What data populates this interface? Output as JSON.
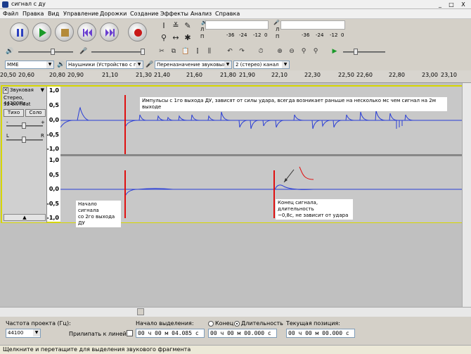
{
  "window": {
    "title": "сигнал с ду",
    "min": "_",
    "max": "□",
    "close": "X"
  },
  "menu": [
    "Файл",
    "Правка",
    "Вид",
    "Управление",
    "Дорожки",
    "Создание",
    "Эффекты",
    "Анализ",
    "Справка"
  ],
  "meters": {
    "playback": {
      "l": "Л",
      "r": "П",
      "ticks": [
        "-36",
        "-24",
        "-12",
        "0"
      ]
    },
    "record": {
      "l": "Л",
      "r": "П",
      "ticks": [
        "-36",
        "-24",
        "-12",
        "0"
      ]
    }
  },
  "device": {
    "host": "MME",
    "output": "Наушники (Устройство с под",
    "input": "Переназначение звуковых у",
    "channels": "2 (стерео) канал"
  },
  "ruler": {
    "ticks": [
      "20,50",
      "20,60",
      "20,80",
      "20,90",
      "21,10",
      "21,30",
      "21,40",
      "21,60",
      "21,80",
      "21,90",
      "22,10",
      "22,30",
      "22,50",
      "22,60",
      "22,80",
      "23,00",
      "23,10"
    ]
  },
  "track": {
    "name": "Звуковая",
    "info1": "Стерео, 44100Hz",
    "info2": "32-bit float",
    "mute": "Тихо",
    "solo": "Соло",
    "gain_minus": "-",
    "gain_plus": "+",
    "pan_l": "L",
    "pan_r": "R",
    "collapse": "▲"
  },
  "axis_labels": [
    "1,0",
    "0,5",
    "0,0",
    "-0,5",
    "-1,0"
  ],
  "annotations": {
    "top": "Импульсы с 1го выхода ДУ, зависят от силы удара, всегда возникает раньше на несколько мс чем сигнал на 2м выходе",
    "start1": "Начало сигнала",
    "start2": "со 2го выхода ДУ",
    "end1": "Конец сигнала, длительность",
    "end2": "~0,8с, не зависит от удара"
  },
  "bottom": {
    "rate_label": "Частота проекта (Гц):",
    "rate_value": "44100",
    "snap_label": "Прилипать к линейке",
    "sel_start_label": "Начало выделения:",
    "end_label": "Конец",
    "len_label": "Длительность",
    "sel_start_value": "00 ч 00 м 04.085 с",
    "sel_len_value": "00 ч 00 м 00.000 с",
    "pos_label": "Текущая позиция:",
    "pos_value": "00 ч 00 м 00.000 с"
  },
  "status": "Щелкните и перетащите для выделения звукового фрагмента",
  "colors": {
    "wave": "#2a3ed6",
    "marker": "#e01010",
    "focus": "#d6d600",
    "track_bg": "#c8c8c8"
  }
}
